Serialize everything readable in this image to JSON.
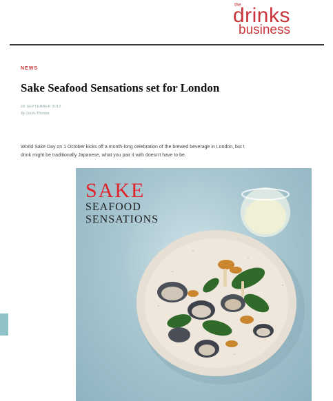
{
  "site": {
    "logo_small": "the",
    "logo_main": "drinks",
    "logo_sub": "business"
  },
  "article": {
    "category": "NEWS",
    "title": "Sake Seafood Sensations set for London",
    "date": "28 SEPTEMBER 2012",
    "author": "By Louis Thomas",
    "body_line1": "World Sake Day on 1 October kicks off a month-long celebration of the brewed beverage in London, but t",
    "body_line2": "drink might be traditionally Japanese, what you pair it with doesn't have to be."
  },
  "hero": {
    "title_line1": "SAKE",
    "title_line2": "SEAFOOD",
    "title_line3": "SENSATIONS",
    "red": "#e0232b"
  },
  "colors": {
    "brand": "#c8343a",
    "rule": "#3a3a3a",
    "teal_tab": "#8fc3c8"
  }
}
